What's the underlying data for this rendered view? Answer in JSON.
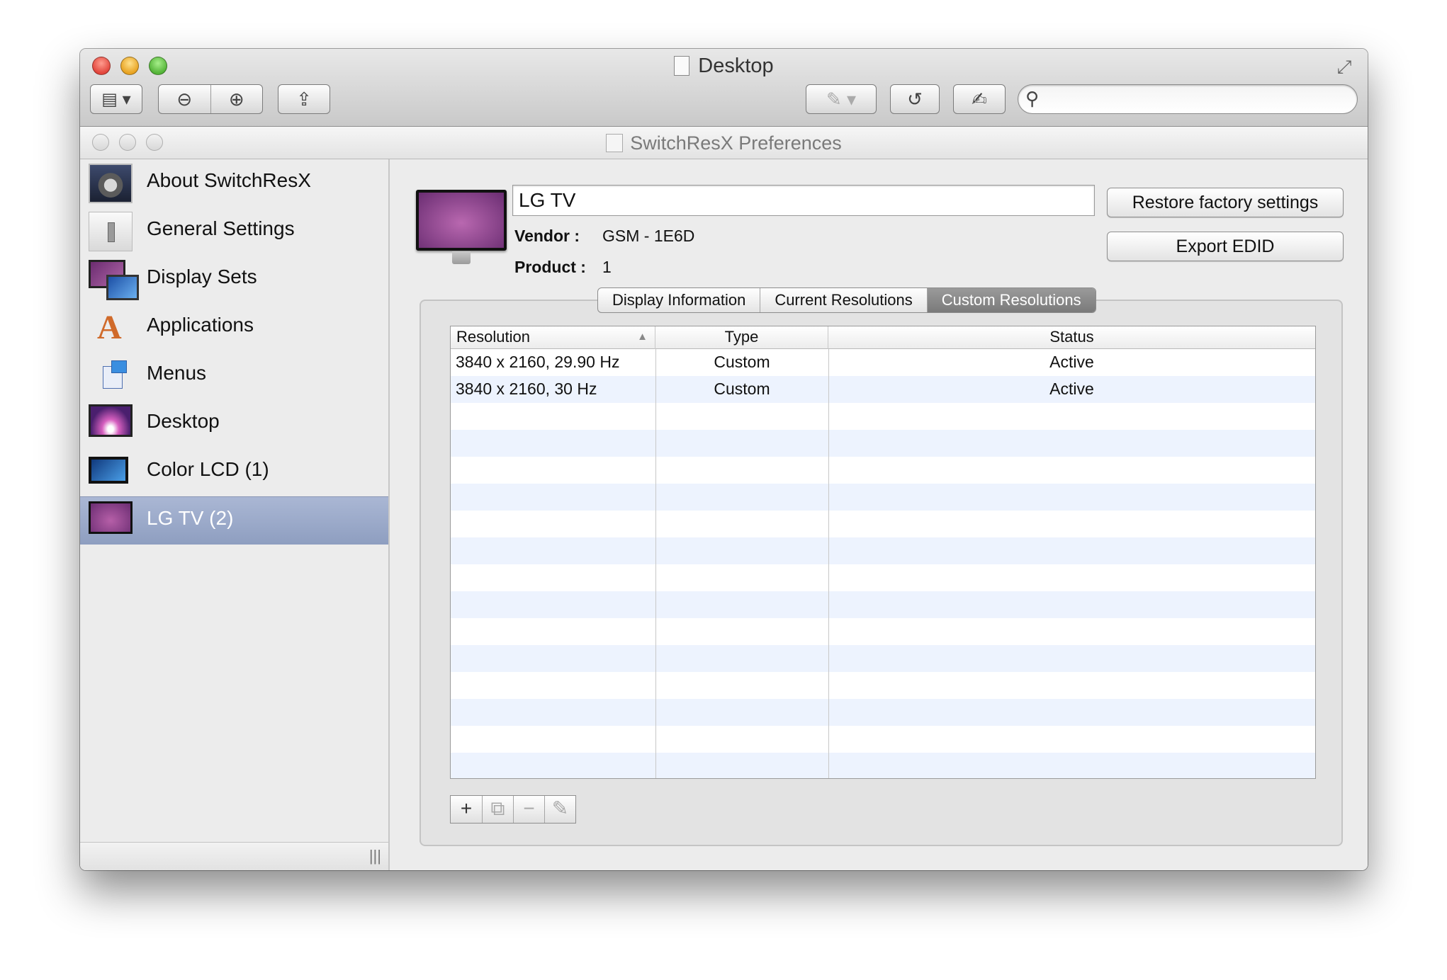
{
  "preview": {
    "title": "Desktop",
    "search_placeholder": ""
  },
  "prefs": {
    "title": "SwitchResX Preferences"
  },
  "sidebar": {
    "items": [
      {
        "label": "About SwitchResX"
      },
      {
        "label": "General Settings"
      },
      {
        "label": "Display Sets"
      },
      {
        "label": "Applications"
      },
      {
        "label": "Menus"
      },
      {
        "label": "Desktop"
      },
      {
        "label": "Color LCD (1)"
      },
      {
        "label": "LG TV (2)"
      }
    ],
    "selected_index": 7
  },
  "display": {
    "name": "LG TV",
    "vendor_label": "Vendor :",
    "vendor_value": "GSM - 1E6D",
    "product_label": "Product :",
    "product_value": "1",
    "restore_label": "Restore factory settings",
    "export_label": "Export EDID"
  },
  "tabs": [
    {
      "label": "Display Information"
    },
    {
      "label": "Current Resolutions"
    },
    {
      "label": "Custom Resolutions"
    }
  ],
  "active_tab": 2,
  "table": {
    "columns": [
      "Resolution",
      "Type",
      "Status"
    ],
    "rows": [
      {
        "resolution": "3840 x 2160, 29.90 Hz",
        "type": "Custom",
        "status": "Active"
      },
      {
        "resolution": "3840 x 2160, 30 Hz",
        "type": "Custom",
        "status": "Active"
      }
    ]
  },
  "icons": {
    "add": "+",
    "duplicate": "⧉",
    "remove": "−",
    "edit": "✎",
    "search": "⚲"
  }
}
